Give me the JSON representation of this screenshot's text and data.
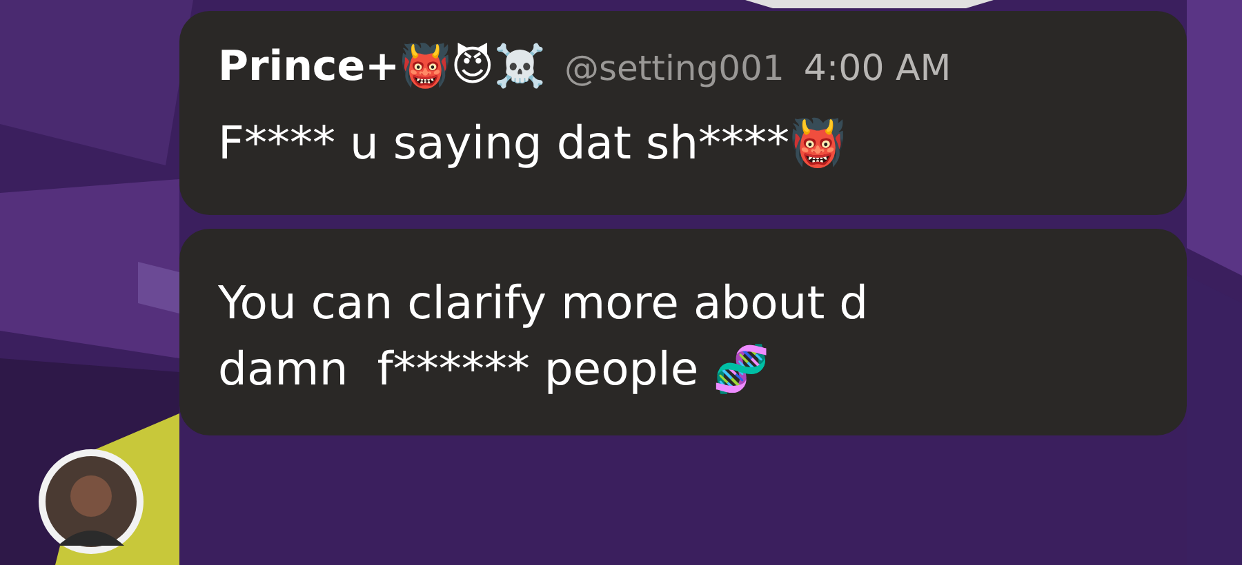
{
  "messages": [
    {
      "author": "Prince+👹😈☠️",
      "handle": "@setting001",
      "time": "4:00 AM",
      "text": "F**** u saying dat sh****👹"
    },
    {
      "text": "You can clarify more about d\ndamn  f****** people 🧬"
    }
  ]
}
